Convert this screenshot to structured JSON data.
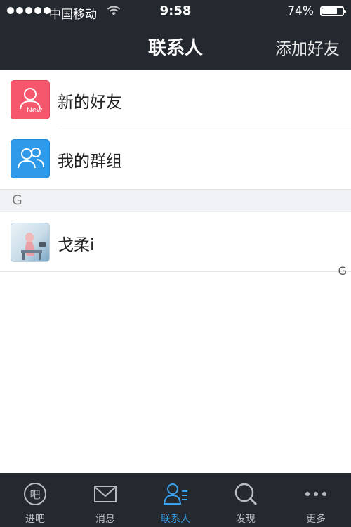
{
  "status_bar": {
    "carrier": "中国移动",
    "time": "9:58",
    "battery_percent": "74%",
    "battery_level": 0.74
  },
  "nav": {
    "title": "联系人",
    "add_friend": "添加好友"
  },
  "list": {
    "new_friends": {
      "label": "新的好友",
      "badge": "New",
      "icon": "new-friend-icon",
      "color": "#f5576c"
    },
    "my_groups": {
      "label": "我的群组",
      "icon": "group-icon",
      "color": "#2f9ae9"
    },
    "section_letter": "G",
    "contacts": [
      {
        "name": "戈柔i"
      }
    ],
    "index_letter": "G"
  },
  "tabs": [
    {
      "label": "进吧",
      "icon": "bar-chat-icon"
    },
    {
      "label": "消息",
      "icon": "envelope-icon"
    },
    {
      "label": "联系人",
      "icon": "contacts-icon",
      "active": true
    },
    {
      "label": "发现",
      "icon": "search-icon"
    },
    {
      "label": "更多",
      "icon": "more-dots-icon"
    }
  ],
  "colors": {
    "bar_bg": "#23292f",
    "active_tab": "#3aa3ef",
    "section_bg": "#f1f2f5"
  }
}
